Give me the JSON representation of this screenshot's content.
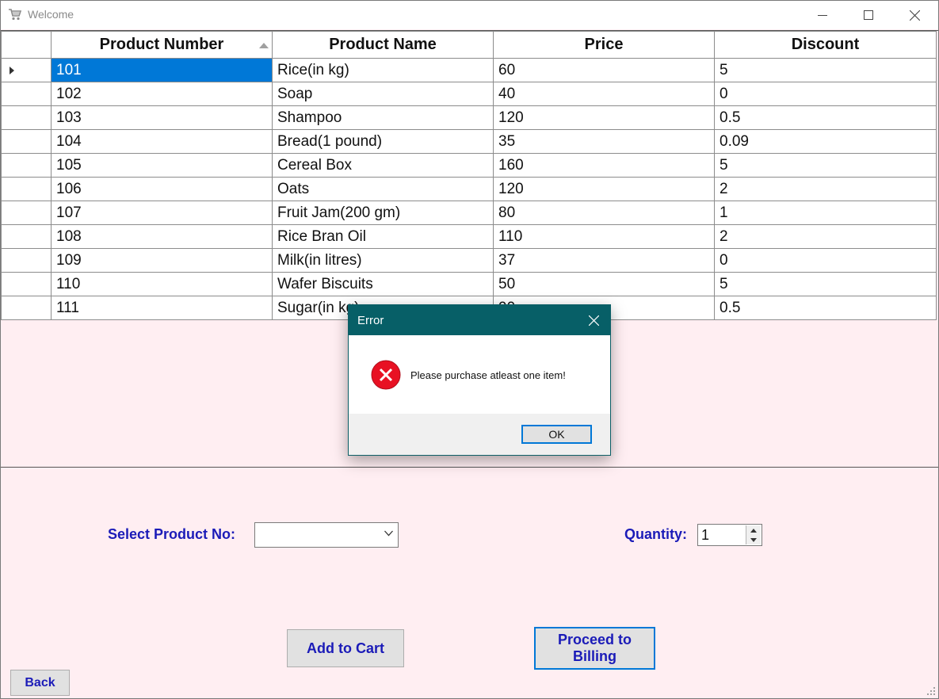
{
  "window": {
    "title": "Welcome",
    "icon": "shopping-cart-icon"
  },
  "grid": {
    "columns": [
      "Product Number",
      "Product Name",
      "Price",
      "Discount"
    ],
    "sorted_column": "Product Number",
    "rows": [
      {
        "num": "101",
        "name": "Rice(in kg)",
        "price": "60",
        "discount": "5"
      },
      {
        "num": "102",
        "name": "Soap",
        "price": "40",
        "discount": "0"
      },
      {
        "num": "103",
        "name": "Shampoo",
        "price": "120",
        "discount": "0.5"
      },
      {
        "num": "104",
        "name": "Bread(1 pound)",
        "price": "35",
        "discount": "0.09"
      },
      {
        "num": "105",
        "name": "Cereal Box",
        "price": "160",
        "discount": "5"
      },
      {
        "num": "106",
        "name": "Oats",
        "price": "120",
        "discount": "2"
      },
      {
        "num": "107",
        "name": "Fruit Jam(200 gm)",
        "price": "80",
        "discount": "1"
      },
      {
        "num": "108",
        "name": "Rice Bran Oil",
        "price": "110",
        "discount": "2"
      },
      {
        "num": "109",
        "name": "Milk(in litres)",
        "price": "37",
        "discount": "0"
      },
      {
        "num": "110",
        "name": "Wafer Biscuits",
        "price": "50",
        "discount": "5"
      },
      {
        "num": "111",
        "name": "Sugar(in kg)",
        "price": "90",
        "discount": "0.5"
      }
    ],
    "selected_row": 0
  },
  "form": {
    "select_product_label": "Select Product No:",
    "select_product_value": "",
    "quantity_label": "Quantity:",
    "quantity_value": "1",
    "add_to_cart": "Add to Cart",
    "proceed_line1": "Proceed to",
    "proceed_line2": "Billing",
    "back": "Back"
  },
  "dialog": {
    "title": "Error",
    "message": "Please purchase atleast one item!",
    "ok": "OK",
    "icon": "error-icon"
  },
  "colors": {
    "background": "#ffeef2",
    "label_blue": "#1b1bb8",
    "selection": "#0078d7",
    "dialog_title": "#075f67",
    "error_red": "#e81123"
  }
}
